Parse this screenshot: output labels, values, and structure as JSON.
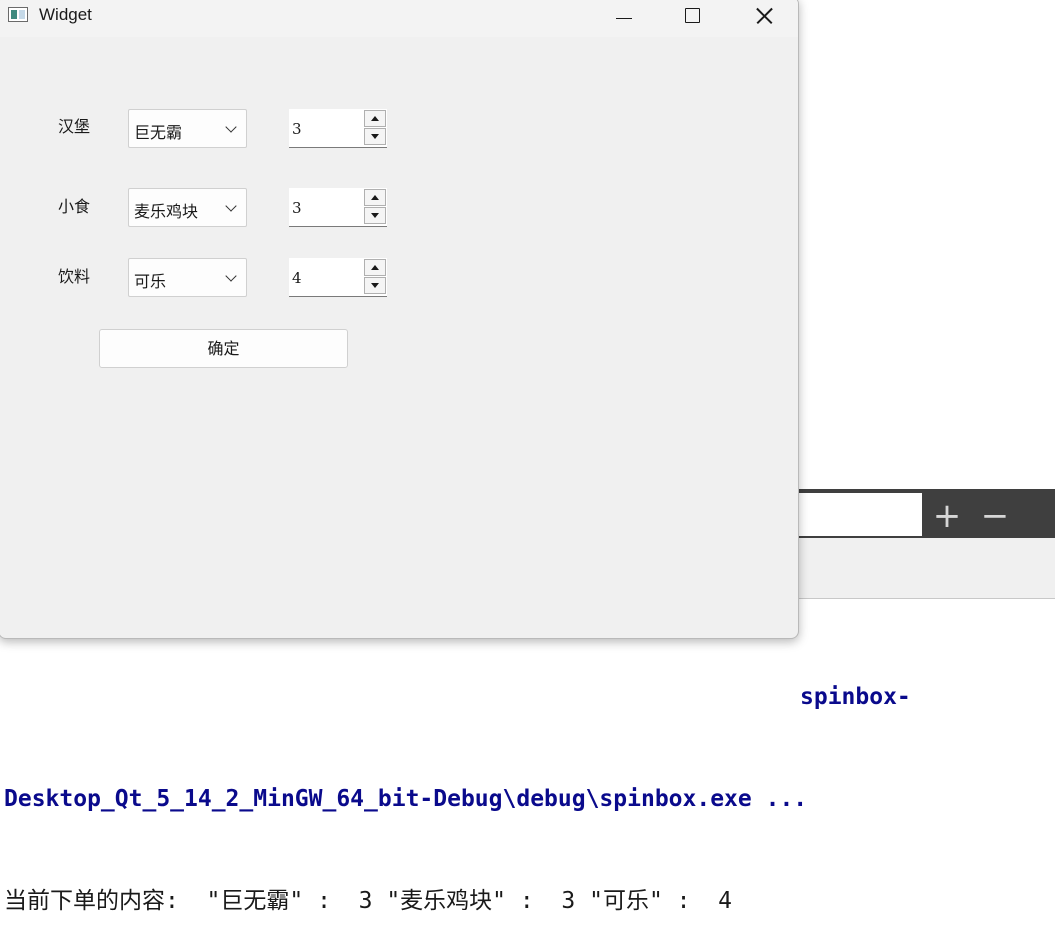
{
  "window": {
    "title": "Widget"
  },
  "form": {
    "rows": [
      {
        "label": "汉堡",
        "combo_value": "巨无霸",
        "spin_value": "3"
      },
      {
        "label": "小食",
        "combo_value": "麦乐鸡块",
        "spin_value": "3"
      },
      {
        "label": "饮料",
        "combo_value": "可乐",
        "spin_value": "4"
      }
    ],
    "confirm_label": "确定"
  },
  "background": {
    "toolbar": {
      "plus_glyph": "+",
      "minus_glyph": "−"
    },
    "console": {
      "lines": [
        "spinbox-",
        "Desktop_Qt_5_14_2_MinGW_64_bit-Debug\\debug\\spinbox.exe ...",
        "当前下单的内容:  \"巨无霸\" :  3 \"麦乐鸡块\" :  3 \"可乐\" :  4"
      ]
    }
  },
  "colors": {
    "console_path": "#0a0a8c",
    "console_text": "#1a1a1a",
    "window_bg": "#f0f0f0",
    "dark_toolbar": "#3f3f3f"
  }
}
